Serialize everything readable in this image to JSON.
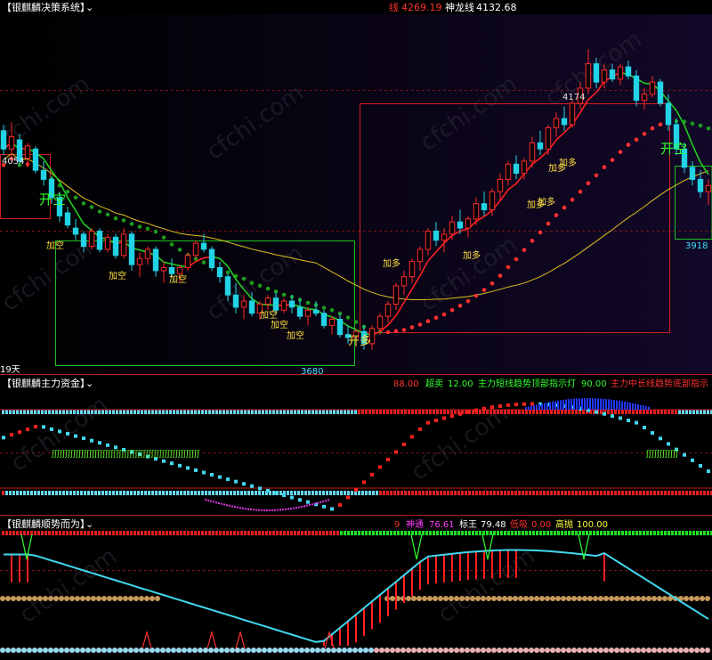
{
  "colors": {
    "background": "#000000",
    "panel_bg": "#05050f",
    "up": "#ff2a2a",
    "down": "#22d3e6",
    "green_line": "#22cc22",
    "yellow_line": "#e0c020",
    "red_line": "#ff2020",
    "dash_grid": "#a01818",
    "white_text": "#ffffff",
    "yellow_text": "#ffe040",
    "green_text": "#30ff30"
  },
  "panel1": {
    "title": "【银麒麟决策系统】",
    "stats": [
      {
        "label": "线",
        "value": "4269.19",
        "color": "#ff3030"
      },
      {
        "label": "神龙线",
        "value": "4132.68",
        "color": "#ffffff"
      }
    ],
    "price_labels": {
      "high_left": "4054",
      "high_mid": "4174",
      "low_mid": "3680",
      "low_right": "3918"
    },
    "kai_kong_left": "开空",
    "kai_kong_right": "开空",
    "kai_duo": "开多",
    "days_label": "19天",
    "jia_kong_labels": [
      "加空",
      "加空",
      "加空",
      "加空",
      "加空",
      "加空"
    ],
    "jia_duo_labels": [
      "加多",
      "加多",
      "加多",
      "加多",
      "加多",
      "加多"
    ]
  },
  "panel2": {
    "title": "【银麒麟主力资金】",
    "stats": [
      {
        "label": "",
        "value": "88.00",
        "color": "#ff3030"
      },
      {
        "label": "超卖",
        "value": "12.00",
        "color": "#30ff30"
      },
      {
        "label": "主力短线趋势顶部指示灯",
        "value": "90.00",
        "color": "#30ff30"
      },
      {
        "label": "主力中长线趋势底部指示",
        "value": "",
        "color": "#ff3030"
      }
    ],
    "runner_glyph": "ʃ"
  },
  "panel3": {
    "title": "【银麒麟顺势而为】",
    "stats": [
      {
        "label": "",
        "value": "9",
        "color": "#ff3030"
      },
      {
        "label": "神通",
        "value": "76.61",
        "color": "#ff40ff"
      },
      {
        "label": "标王",
        "value": "79.48",
        "color": "#ffffff"
      },
      {
        "label": "低吸",
        "value": "0.00",
        "color": "#ff3030"
      },
      {
        "label": "高抛",
        "value": "100.00",
        "color": "#ffff40"
      }
    ]
  },
  "watermark": "cfchi.com",
  "chart_data": [
    {
      "type": "candlestick",
      "title": "【银麒麟决策系统】",
      "ylim": [
        3640,
        4230
      ],
      "candles": [
        [
          4040,
          4050,
          4000,
          4010
        ],
        [
          4010,
          4054,
          3995,
          4030
        ],
        [
          4025,
          4035,
          3985,
          3990
        ],
        [
          3995,
          4020,
          3980,
          4015
        ],
        [
          4010,
          4015,
          3970,
          3975
        ],
        [
          3975,
          3990,
          3950,
          3960
        ],
        [
          3960,
          3965,
          3920,
          3930
        ],
        [
          3930,
          3940,
          3890,
          3900
        ],
        [
          3905,
          3915,
          3880,
          3885
        ],
        [
          3880,
          3895,
          3860,
          3870
        ],
        [
          3870,
          3875,
          3840,
          3850
        ],
        [
          3850,
          3880,
          3845,
          3875
        ],
        [
          3875,
          3880,
          3840,
          3845
        ],
        [
          3845,
          3870,
          3840,
          3865
        ],
        [
          3865,
          3870,
          3830,
          3835
        ],
        [
          3835,
          3880,
          3830,
          3870
        ],
        [
          3870,
          3875,
          3810,
          3820
        ],
        [
          3820,
          3840,
          3800,
          3830
        ],
        [
          3830,
          3850,
          3820,
          3845
        ],
        [
          3845,
          3850,
          3800,
          3810
        ],
        [
          3810,
          3825,
          3790,
          3815
        ],
        [
          3815,
          3830,
          3800,
          3805
        ],
        [
          3805,
          3820,
          3790,
          3815
        ],
        [
          3815,
          3840,
          3810,
          3835
        ],
        [
          3835,
          3860,
          3830,
          3855
        ],
        [
          3855,
          3870,
          3840,
          3845
        ],
        [
          3845,
          3850,
          3810,
          3815
        ],
        [
          3815,
          3825,
          3790,
          3800
        ],
        [
          3800,
          3805,
          3760,
          3770
        ],
        [
          3770,
          3790,
          3740,
          3750
        ],
        [
          3750,
          3770,
          3730,
          3760
        ],
        [
          3760,
          3775,
          3735,
          3740
        ],
        [
          3740,
          3760,
          3730,
          3755
        ],
        [
          3755,
          3770,
          3745,
          3765
        ],
        [
          3765,
          3775,
          3740,
          3745
        ],
        [
          3745,
          3765,
          3740,
          3760
        ],
        [
          3760,
          3770,
          3740,
          3750
        ],
        [
          3750,
          3765,
          3730,
          3735
        ],
        [
          3735,
          3750,
          3720,
          3745
        ],
        [
          3745,
          3760,
          3735,
          3740
        ],
        [
          3740,
          3745,
          3715,
          3720
        ],
        [
          3720,
          3735,
          3705,
          3730
        ],
        [
          3730,
          3740,
          3700,
          3705
        ],
        [
          3705,
          3720,
          3690,
          3700
        ],
        [
          3700,
          3715,
          3685,
          3710
        ],
        [
          3710,
          3720,
          3680,
          3690
        ],
        [
          3690,
          3720,
          3680,
          3715
        ],
        [
          3715,
          3740,
          3705,
          3735
        ],
        [
          3735,
          3760,
          3725,
          3755
        ],
        [
          3755,
          3790,
          3745,
          3785
        ],
        [
          3785,
          3810,
          3770,
          3800
        ],
        [
          3800,
          3830,
          3790,
          3825
        ],
        [
          3825,
          3850,
          3810,
          3845
        ],
        [
          3845,
          3880,
          3835,
          3875
        ],
        [
          3875,
          3890,
          3850,
          3860
        ],
        [
          3860,
          3880,
          3840,
          3870
        ],
        [
          3870,
          3900,
          3860,
          3890
        ],
        [
          3890,
          3910,
          3870,
          3880
        ],
        [
          3880,
          3900,
          3865,
          3895
        ],
        [
          3895,
          3930,
          3885,
          3920
        ],
        [
          3920,
          3940,
          3900,
          3910
        ],
        [
          3910,
          3945,
          3900,
          3940
        ],
        [
          3940,
          3970,
          3925,
          3960
        ],
        [
          3960,
          3990,
          3950,
          3985
        ],
        [
          3985,
          4000,
          3960,
          3970
        ],
        [
          3970,
          3995,
          3960,
          3990
        ],
        [
          3990,
          4030,
          3980,
          4020
        ],
        [
          4020,
          4040,
          4000,
          4010
        ],
        [
          4010,
          4050,
          4000,
          4045
        ],
        [
          4045,
          4070,
          4030,
          4060
        ],
        [
          4060,
          4080,
          4040,
          4050
        ],
        [
          4050,
          4090,
          4045,
          4085
        ],
        [
          4085,
          4120,
          4075,
          4110
        ],
        [
          4110,
          4174,
          4100,
          4150
        ],
        [
          4150,
          4160,
          4110,
          4120
        ],
        [
          4120,
          4150,
          4110,
          4140
        ],
        [
          4140,
          4150,
          4120,
          4125
        ],
        [
          4125,
          4150,
          4115,
          4145
        ],
        [
          4145,
          4155,
          4125,
          4130
        ],
        [
          4130,
          4140,
          4080,
          4090
        ],
        [
          4090,
          4110,
          4075,
          4100
        ],
        [
          4100,
          4130,
          4095,
          4120
        ],
        [
          4120,
          4125,
          4080,
          4085
        ],
        [
          4085,
          4100,
          4040,
          4050
        ],
        [
          4050,
          4060,
          4000,
          4010
        ],
        [
          4010,
          4020,
          3970,
          3980
        ],
        [
          3980,
          3990,
          3950,
          3960
        ],
        [
          3960,
          3975,
          3930,
          3940
        ],
        [
          3940,
          3960,
          3918,
          3950
        ]
      ]
    },
    {
      "type": "line",
      "title": "【银麒麟主力资金】",
      "ylim": [
        0,
        100
      ]
    },
    {
      "type": "bar",
      "title": "【银麒麟顺势而为】",
      "ylim": [
        0,
        100
      ]
    }
  ]
}
